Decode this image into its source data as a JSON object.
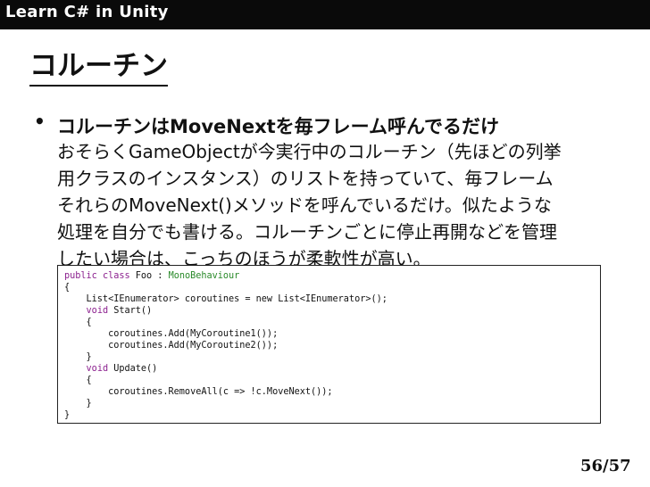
{
  "header": {
    "title": "Learn C# in Unity"
  },
  "slide": {
    "title": "コルーチン",
    "bullet": "コルーチンはMoveNextを毎フレーム呼んでるだけ",
    "body_lines": [
      "おそらくGameObjectが今実行中のコルーチン（先ほどの列挙",
      "用クラスのインスタンス）のリストを持っていて、毎フレーム",
      "それらのMoveNext()メソッドを呼んでいるだけ。似たような",
      "処理を自分でも書ける。コルーチンごとに停止再開などを管理",
      "したい場合は、こっちのほうが柔軟性が高い。"
    ]
  },
  "code": {
    "l1": {
      "kw1": "public",
      "kw2": "class",
      "name": " Foo : ",
      "base": "MonoBehaviour"
    },
    "l2": "{",
    "l3": "    List<IEnumerator> coroutines = new List<IEnumerator>();",
    "l4": {
      "kw": "void",
      "rest": " Start()"
    },
    "l5": "    {",
    "l6": "        coroutines.Add(MyCoroutine1());",
    "l7": "        coroutines.Add(MyCoroutine2());",
    "l8": "    }",
    "l9": {
      "kw": "void",
      "rest": " Update()"
    },
    "l10": "    {",
    "l11": "        coroutines.RemoveAll(c => !c.MoveNext());",
    "l12": "    }",
    "l13": "}"
  },
  "footer": {
    "page": "56/57"
  },
  "colors": {
    "keyword": "#8b1f8e",
    "type": "#2a8a2a",
    "header_bg": "#0a0a0a"
  }
}
